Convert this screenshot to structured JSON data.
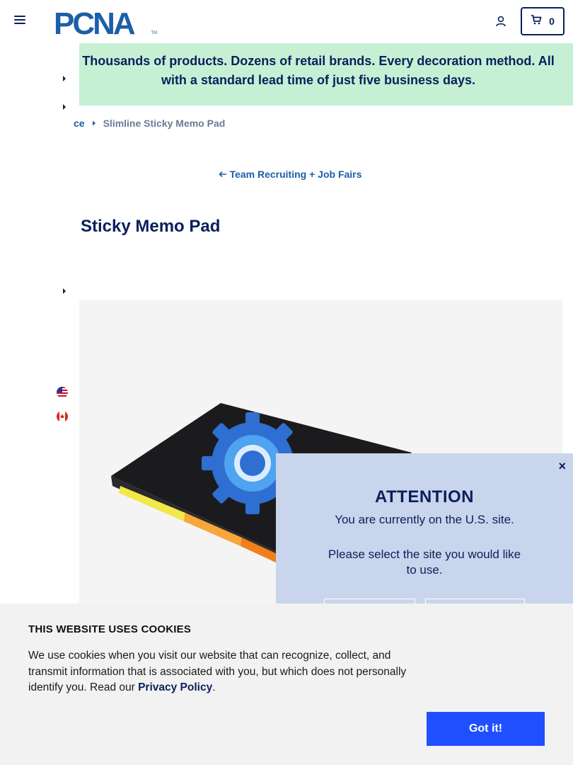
{
  "header": {
    "logo_text": "PCNA",
    "logo_tm": "TM",
    "cart_count": "0"
  },
  "promo": {
    "text": "Thousands of products. Dozens of retail brands. Every decoration method. All with a standard lead time of just five business days."
  },
  "breadcrumb": {
    "parent_label": "ce",
    "current_label": "Slimline Sticky Memo Pad"
  },
  "back_link": {
    "label": "Team Recruiting + Job Fairs"
  },
  "product": {
    "title": "Sticky Memo Pad"
  },
  "attention": {
    "close_label": "×",
    "title": "ATTENTION",
    "current_site": "You are currently on the U.S. site.",
    "select_prompt": "Please select the site you would like to use."
  },
  "cookies": {
    "title": "THIS WEBSITE USES COOKIES",
    "text_before_link": "We use cookies when you visit our website that can recognize, collect, and transmit information that is associated with you, but which does not personally identify you. Read our ",
    "link_label": "Privacy Policy",
    "text_after_link": ".",
    "accept_label": "Got it!"
  },
  "colors": {
    "navy": "#0b1f5c",
    "brand_blue": "#1c5ea8",
    "promo_bg": "#c6f0d4",
    "modal_bg": "#c9d5ec",
    "cookie_button": "#1f4fff"
  },
  "icons": [
    "hamburger-icon",
    "account-icon",
    "cart-icon",
    "chevron-right-icon",
    "us-flag-icon",
    "canada-flag-icon",
    "arrow-left-icon",
    "close-icon"
  ]
}
